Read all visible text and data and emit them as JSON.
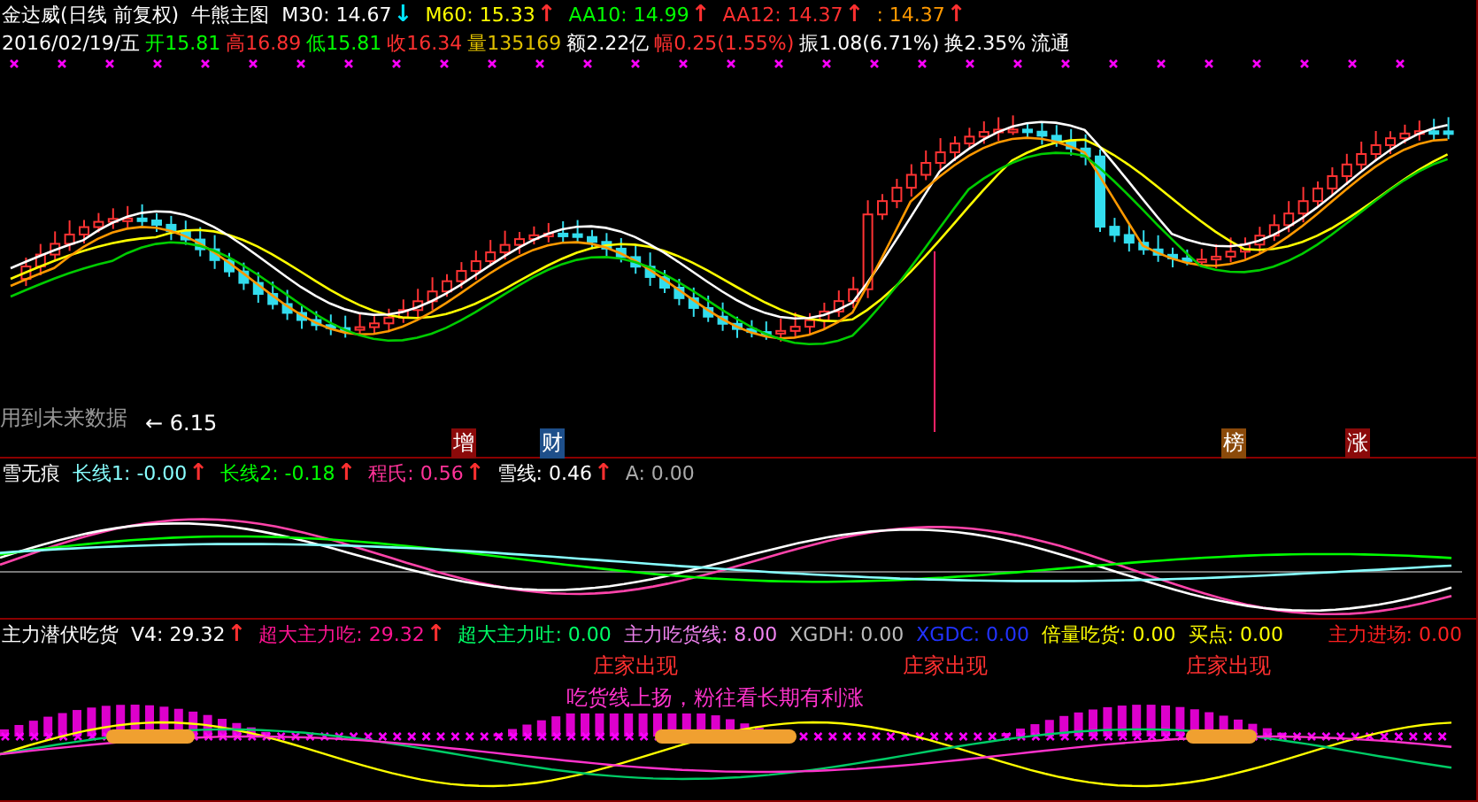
{
  "title": {
    "stock": "金达威(日线 前复权)",
    "chart": "牛熊主图"
  },
  "main_indicators": [
    {
      "label": "M30: 14.67",
      "color": "#ffffff",
      "arrow": "↓",
      "falling": true
    },
    {
      "label": "M60: 15.33",
      "color": "#ffff00",
      "arrow": "↑",
      "falling": false
    },
    {
      "label": "AA10: 14.99",
      "color": "#00ff00",
      "arrow": "↑",
      "falling": false
    },
    {
      "label": "AA12: 14.37",
      "color": "#ff3030",
      "arrow": "↑",
      "falling": false
    },
    {
      "label": ": 14.37",
      "color": "#ff9900",
      "arrow": "↑",
      "falling": false
    }
  ],
  "quote": [
    {
      "text": "2016/02/19/五",
      "color": "#ffffff"
    },
    {
      "text": "开15.81",
      "color": "#00ff00"
    },
    {
      "text": "高16.89",
      "color": "#ff3030"
    },
    {
      "text": "低15.81",
      "color": "#00ff00"
    },
    {
      "text": "收16.34",
      "color": "#ff3030"
    },
    {
      "text": "量135169",
      "color": "#e0c000"
    },
    {
      "text": "额2.22亿",
      "color": "#ffffff"
    },
    {
      "text": "幅0.25(1.55%)",
      "color": "#ff3030"
    },
    {
      "text": "振1.08(6.71%)",
      "color": "#ffffff"
    },
    {
      "text": "换2.35%",
      "color": "#ffffff"
    },
    {
      "text": "流通",
      "color": "#ffffff"
    }
  ],
  "main_notes": {
    "future_data": "用到未来数据",
    "low_marker": "← 6.15"
  },
  "badges": [
    {
      "text": "增",
      "color": "#8b0a0a"
    },
    {
      "text": "财",
      "color": "#1e4f8a"
    },
    {
      "text": "榜",
      "color": "#8b4a0a"
    },
    {
      "text": "涨",
      "color": "#8b0a0a"
    }
  ],
  "sub_panel": {
    "name": "雪无痕",
    "indicators": [
      {
        "label": "长线1: -0.00",
        "color": "#88ffff",
        "arrow": "↑",
        "falling": false
      },
      {
        "label": "长线2: -0.18",
        "color": "#00ff00",
        "arrow": "↑",
        "falling": false
      },
      {
        "label": "程氏: 0.56",
        "color": "#ff3399",
        "arrow": "↑",
        "falling": false
      },
      {
        "label": "雪线: 0.46",
        "color": "#ffffff",
        "arrow": "↑",
        "falling": false
      },
      {
        "label": "A: 0.00",
        "color": "#aaaaaa"
      }
    ]
  },
  "bottom_panel": {
    "name": "主力潜伏吃货",
    "indicators": [
      {
        "label": "V4: 29.32",
        "color": "#ffffff",
        "arrow": "↑",
        "falling": false
      },
      {
        "label": "超大主力吃: 29.32",
        "color": "#ff1493",
        "arrow": "↑",
        "falling": false
      },
      {
        "label": "超大主力吐: 0.00",
        "color": "#00ff66"
      },
      {
        "label": "主力吃货线: 8.00",
        "color": "#ee82ee"
      },
      {
        "label": "XGDH: 0.00",
        "color": "#bbbbbb"
      },
      {
        "label": "XGDC: 0.00",
        "color": "#2233ff"
      },
      {
        "label": "倍量吃货: 0.00",
        "color": "#ffff00"
      },
      {
        "label": "买点: 0.00",
        "color": "#ffff00"
      }
    ],
    "right_indicator": {
      "label": "主力进场: 0.00",
      "color": "#ff2020"
    },
    "signals": [
      "庄家出现",
      "庄家出现",
      "庄家出现"
    ],
    "callout": "吃货线上扬，粉往看长期有利涨"
  }
}
